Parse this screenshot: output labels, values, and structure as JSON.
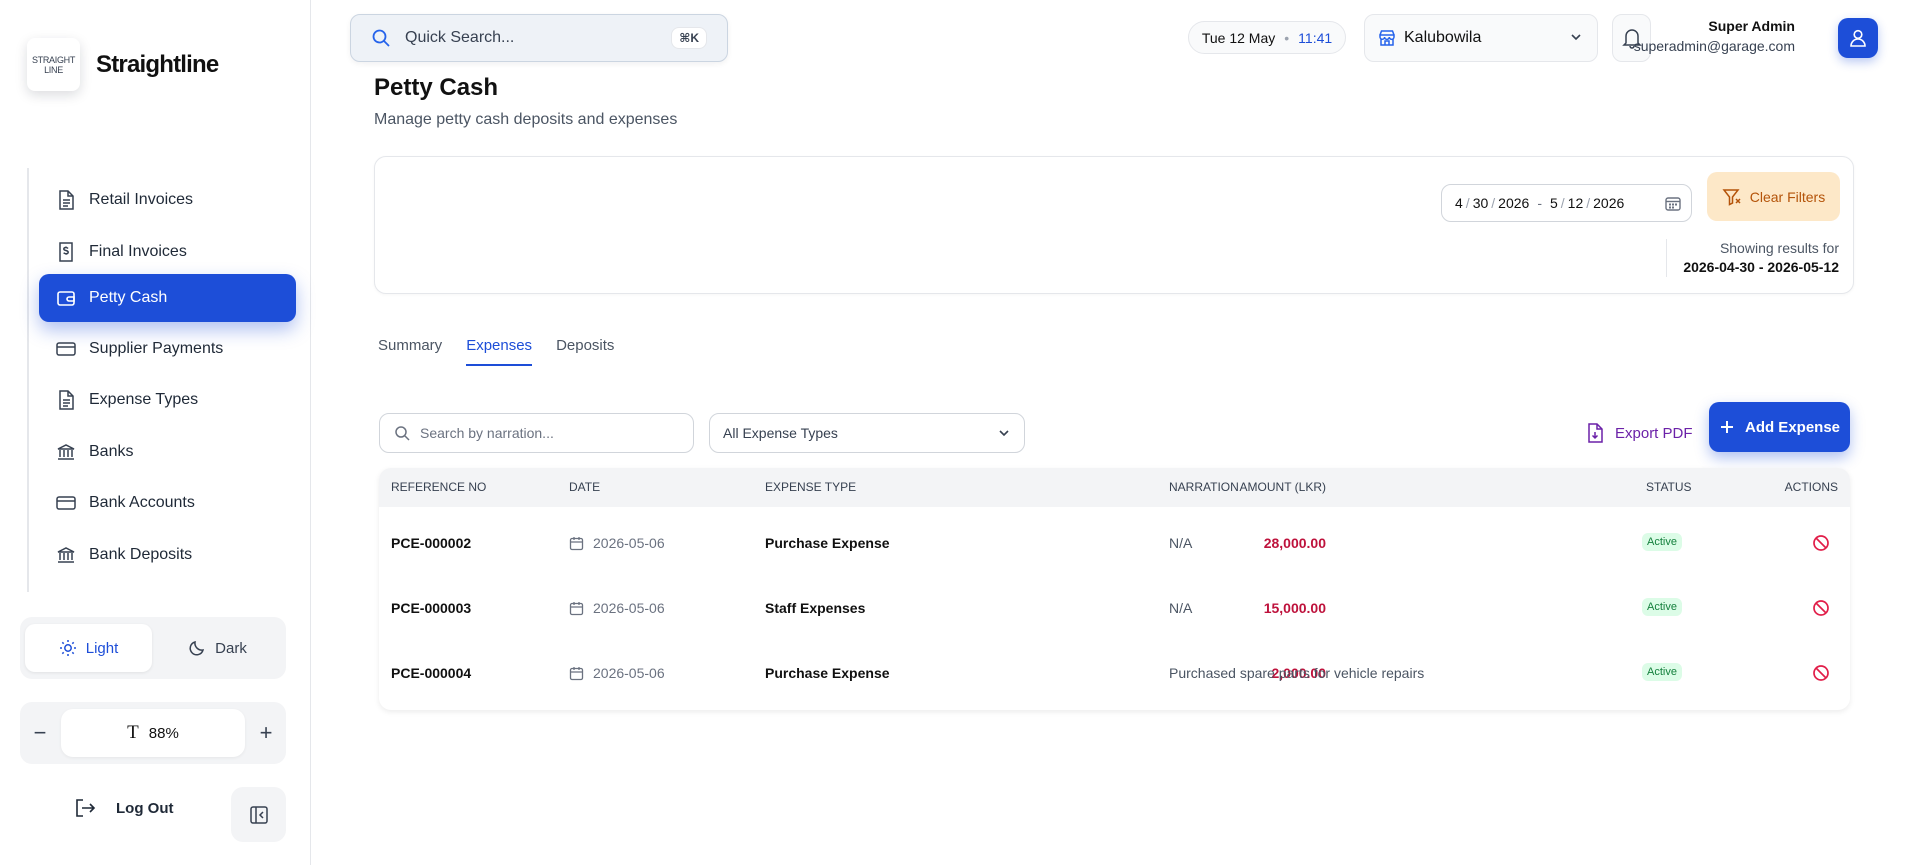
{
  "brand": {
    "logo_line1": "STRAIGHT",
    "logo_line2": "LINE",
    "name": "Straightline"
  },
  "sidebar": {
    "items": [
      {
        "label": "Retail Invoices",
        "icon": "file-text-icon"
      },
      {
        "label": "Final Invoices",
        "icon": "file-dollar-icon"
      },
      {
        "label": "Petty Cash",
        "icon": "wallet-icon",
        "active": true
      },
      {
        "label": "Supplier Payments",
        "icon": "credit-card-icon"
      },
      {
        "label": "Expense Types",
        "icon": "file-text-icon"
      },
      {
        "label": "Banks",
        "icon": "bank-icon"
      },
      {
        "label": "Bank Accounts",
        "icon": "credit-card-icon"
      },
      {
        "label": "Bank Deposits",
        "icon": "bank-icon"
      }
    ],
    "theme": {
      "light": "Light",
      "dark": "Dark",
      "selected": "Light"
    },
    "zoom": {
      "minus": "−",
      "value": "88%",
      "plus": "+"
    },
    "logout": "Log Out"
  },
  "header": {
    "search_placeholder": "Quick Search...",
    "search_shortcut": "⌘K",
    "date": "Tue 12 May",
    "time": "11:41",
    "branch": "Kalubowila",
    "user_name": "Super Admin",
    "user_email": "superadmin@garage.com"
  },
  "page": {
    "title": "Petty Cash",
    "subtitle": "Manage petty cash deposits and expenses"
  },
  "filters": {
    "from": {
      "m": "4",
      "d": "30",
      "y": "2026"
    },
    "to": {
      "m": "5",
      "d": "12",
      "y": "2026"
    },
    "clear_label": "Clear Filters",
    "showing_label": "Showing results for",
    "showing_range": "2026-04-30 - 2026-05-12"
  },
  "tabs": [
    {
      "label": "Summary"
    },
    {
      "label": "Expenses",
      "active": true
    },
    {
      "label": "Deposits"
    }
  ],
  "toolbar": {
    "search_placeholder": "Search by narration...",
    "type_select": "All Expense Types",
    "export_label": "Export PDF",
    "add_label": "Add Expense"
  },
  "table": {
    "columns": [
      "REFERENCE NO",
      "DATE",
      "EXPENSE TYPE",
      "AMOUNT (LKR)",
      "NARRATION",
      "STATUS",
      "ACTIONS"
    ],
    "rows": [
      {
        "ref": "PCE-000002",
        "date": "2026-05-06",
        "type": "Purchase Expense",
        "amount": "28,000.00",
        "narration": "N/A",
        "status": "Active"
      },
      {
        "ref": "PCE-000003",
        "date": "2026-05-06",
        "type": "Staff Expenses",
        "amount": "15,000.00",
        "narration": "N/A",
        "status": "Active"
      },
      {
        "ref": "PCE-000004",
        "date": "2026-05-06",
        "type": "Purchase Expense",
        "amount": "2,000.00",
        "narration": "Purchased spare parts for vehicle repairs",
        "status": "Active"
      }
    ]
  },
  "colors": {
    "primary": "#1d4ed8",
    "amount": "#be123c",
    "status_bg": "#dcfce7",
    "status_fg": "#15803d",
    "clear_bg": "#fde8c8"
  }
}
